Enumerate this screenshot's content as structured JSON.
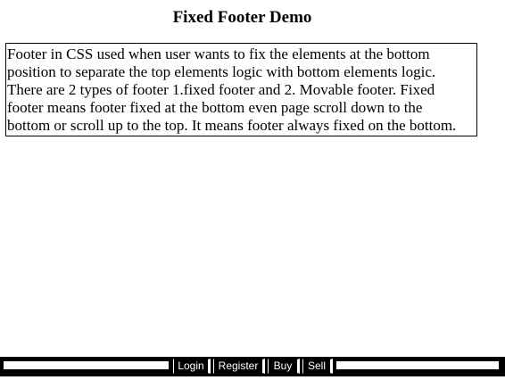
{
  "page": {
    "title": "Fixed Footer Demo",
    "paragraph_lines": [
      "Footer in CSS used when user wants to fix the elements at the bottom",
      "position to separate the top elements logic with bottom elements logic.",
      "There are 2 types of footer 1.fixed footer and 2. Movable footer. Fixed",
      "footer means footer fixed at the bottom even page scroll down to the",
      "bottom or scroll up to the top. It means footer always fixed on the bottom."
    ]
  },
  "footer": {
    "background": "#000000",
    "buttons": {
      "login": "Login",
      "register": "Register",
      "buy": "Buy",
      "sell": "Sell"
    }
  }
}
